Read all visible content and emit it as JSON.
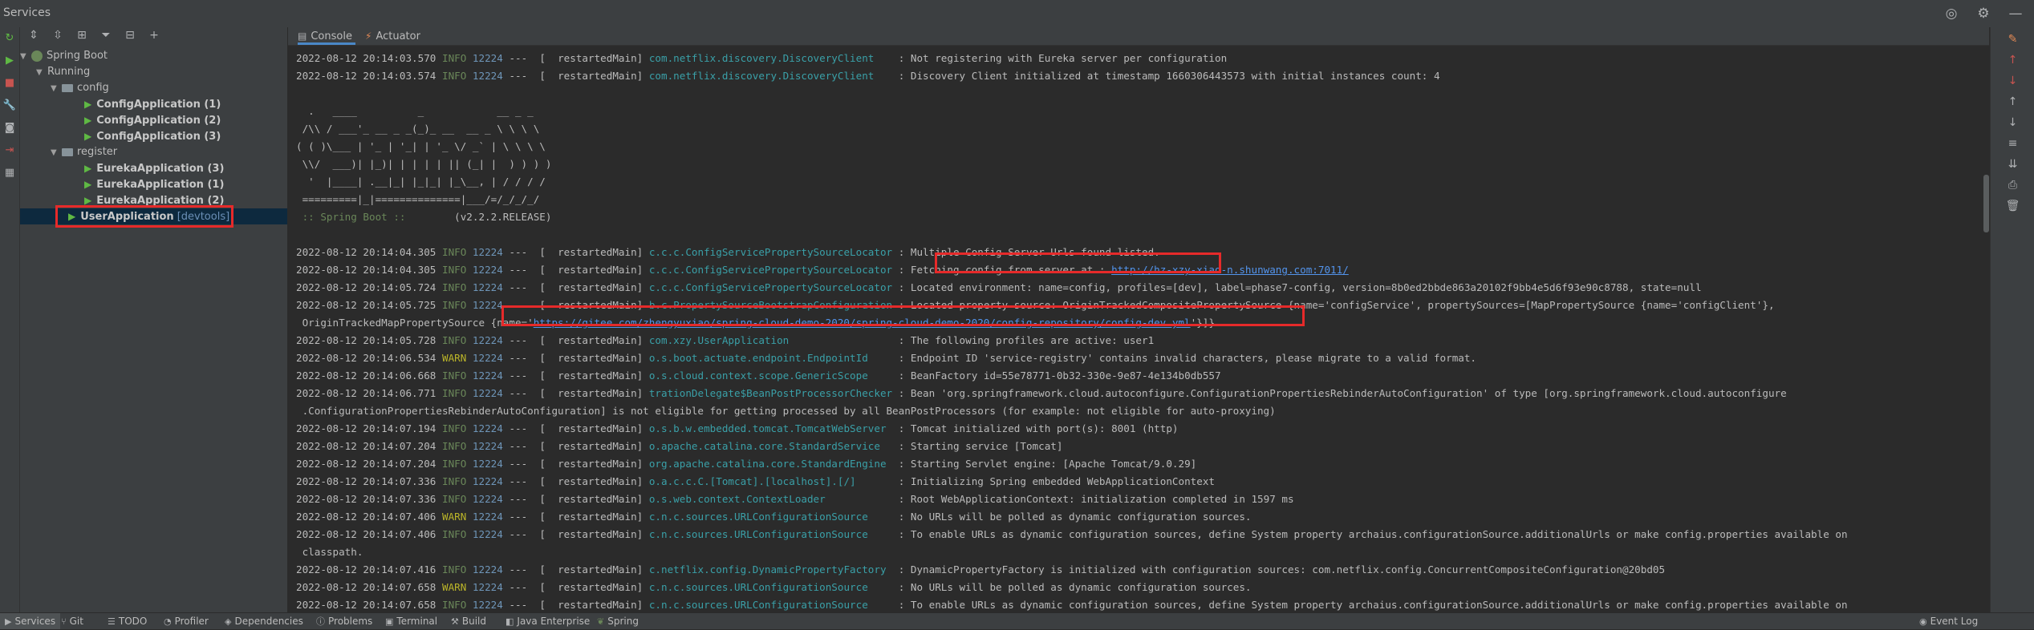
{
  "window": {
    "title": "Services"
  },
  "left_toolbar": {
    "icons": [
      "refresh-icon",
      "run-icon",
      "stop-icon",
      "wrench-icon",
      "camera-icon",
      "exit-icon",
      "layout-icon"
    ]
  },
  "tree_toolbar": {
    "icons": [
      "expand-all-icon",
      "collapse-all-icon",
      "group-icon",
      "filter-icon",
      "new-group-icon",
      "add-service-icon"
    ]
  },
  "tree": {
    "root": "Spring Boot",
    "running": "Running",
    "config_group": "config",
    "config_apps": [
      "ConfigApplication (1)",
      "ConfigApplication (2)",
      "ConfigApplication (3)"
    ],
    "register_group": "register",
    "register_apps": [
      "EurekaApplication (3)",
      "EurekaApplication (1)",
      "EurekaApplication (2)"
    ],
    "user_app": "UserApplication",
    "user_app_tag": "[devtools]"
  },
  "tabs": {
    "console": "Console",
    "actuator": "Actuator"
  },
  "console": {
    "lines": [
      {
        "type": "log",
        "ts": "2022-08-12 20:14:03.570",
        "level": "INFO",
        "pid": "12224",
        "thread": "---  [  restartedMain]",
        "logger": "com.netflix.discovery.DiscoveryClient    ",
        "msg": ": Not registering with Eureka server per configuration"
      },
      {
        "type": "log",
        "ts": "2022-08-12 20:14:03.574",
        "level": "INFO",
        "pid": "12224",
        "thread": "---  [  restartedMain]",
        "logger": "com.netflix.discovery.DiscoveryClient    ",
        "msg": ": Discovery Client initialized at timestamp 1660306443573 with initial instances count: 4"
      },
      {
        "type": "blank"
      },
      {
        "type": "banner",
        "text": "  .   ____          _            __ _ _"
      },
      {
        "type": "banner",
        "text": " /\\\\ / ___'_ __ _ _(_)_ __  __ _ \\ \\ \\ \\"
      },
      {
        "type": "banner",
        "text": "( ( )\\___ | '_ | '_| | '_ \\/ _` | \\ \\ \\ \\"
      },
      {
        "type": "banner",
        "text": " \\\\/  ___)| |_)| | | | | || (_| |  ) ) ) )"
      },
      {
        "type": "banner",
        "text": "  '  |____| .__|_| |_|_| |_\\__, | / / / /"
      },
      {
        "type": "banner",
        "text": " =========|_|==============|___/=/_/_/_/"
      },
      {
        "type": "sbver",
        "label": " :: Spring Boot :: ",
        "version": "       (v2.2.2.RELEASE)"
      },
      {
        "type": "blank"
      },
      {
        "type": "log",
        "ts": "2022-08-12 20:14:04.305",
        "level": "INFO",
        "pid": "12224",
        "thread": "---  [  restartedMain]",
        "logger": "c.c.c.ConfigServicePropertySourceLocator ",
        "msg": ": Multiple Config Server Urls found listed."
      },
      {
        "type": "fetch",
        "ts": "2022-08-12 20:14:04.305",
        "level": "INFO",
        "pid": "12224",
        "thread": "---  [  restartedMain]",
        "logger": "c.c.c.ConfigServicePropertySourceLocator ",
        "msg": ": Fetching config from server at : ",
        "url": "http://hz-xzy-xiao-n.shunwang.com:7011/"
      },
      {
        "type": "log",
        "ts": "2022-08-12 20:14:05.724",
        "level": "INFO",
        "pid": "12224",
        "thread": "---  [  restartedMain]",
        "logger": "c.c.c.ConfigServicePropertySourceLocator ",
        "msg": ": Located environment: name=config, profiles=[dev], label=phase7-config, version=8b0ed2bbde863a20102f9bb4e5d6f93e90c8788, state=null"
      },
      {
        "type": "log",
        "ts": "2022-08-12 20:14:05.725",
        "level": "INFO",
        "pid": "12224",
        "thread": "---  [  restartedMain]",
        "logger": "b.c.PropertySourceBootstrapConfiguration ",
        "msg": ": Located property source: OriginTrackedCompositePropertySource {name='configService', propertySources=[MapPropertySource {name='configClient'},"
      },
      {
        "type": "cont_url",
        "pre": " OriginTrackedMapPropertySource ",
        "a": "{name='",
        "url": "https://gitee.com/zhengyuxiao/spring-cloud-demo-2020/spring-cloud-demo-2020/config-repository/config-dev.yml",
        "b": "'}]}"
      },
      {
        "type": "log",
        "ts": "2022-08-12 20:14:05.728",
        "level": "INFO",
        "pid": "12224",
        "thread": "---  [  restartedMain]",
        "logger": "com.xzy.UserApplication                  ",
        "msg": ": The following profiles are active: user1"
      },
      {
        "type": "log",
        "ts": "2022-08-12 20:14:06.534",
        "level": "WARN",
        "pid": "12224",
        "thread": "---  [  restartedMain]",
        "logger": "o.s.boot.actuate.endpoint.EndpointId     ",
        "msg": ": Endpoint ID 'service-registry' contains invalid characters, please migrate to a valid format."
      },
      {
        "type": "log",
        "ts": "2022-08-12 20:14:06.668",
        "level": "INFO",
        "pid": "12224",
        "thread": "---  [  restartedMain]",
        "logger": "o.s.cloud.context.scope.GenericScope     ",
        "msg": ": BeanFactory id=55e78771-0b32-330e-9e87-4e134b0db557"
      },
      {
        "type": "log",
        "ts": "2022-08-12 20:14:06.771",
        "level": "INFO",
        "pid": "12224",
        "thread": "---  [  restartedMain]",
        "logger": "trationDelegate$BeanPostProcessorChecker ",
        "msg": ": Bean 'org.springframework.cloud.autoconfigure.ConfigurationPropertiesRebinderAutoConfiguration' of type [org.springframework.cloud.autoconfigure"
      },
      {
        "type": "cont",
        "text": " .ConfigurationPropertiesRebinderAutoConfiguration] is not eligible for getting processed by all BeanPostProcessors (for example: not eligible for auto-proxying)"
      },
      {
        "type": "log",
        "ts": "2022-08-12 20:14:07.194",
        "level": "INFO",
        "pid": "12224",
        "thread": "---  [  restartedMain]",
        "logger": "o.s.b.w.embedded.tomcat.TomcatWebServer  ",
        "msg": ": Tomcat initialized with port(s): 8001 (http)"
      },
      {
        "type": "log",
        "ts": "2022-08-12 20:14:07.204",
        "level": "INFO",
        "pid": "12224",
        "thread": "---  [  restartedMain]",
        "logger": "o.apache.catalina.core.StandardService   ",
        "msg": ": Starting service [Tomcat]"
      },
      {
        "type": "log",
        "ts": "2022-08-12 20:14:07.204",
        "level": "INFO",
        "pid": "12224",
        "thread": "---  [  restartedMain]",
        "logger": "org.apache.catalina.core.StandardEngine  ",
        "msg": ": Starting Servlet engine: [Apache Tomcat/9.0.29]"
      },
      {
        "type": "log",
        "ts": "2022-08-12 20:14:07.336",
        "level": "INFO",
        "pid": "12224",
        "thread": "---  [  restartedMain]",
        "logger": "o.a.c.c.C.[Tomcat].[localhost].[/]       ",
        "msg": ": Initializing Spring embedded WebApplicationContext"
      },
      {
        "type": "log",
        "ts": "2022-08-12 20:14:07.336",
        "level": "INFO",
        "pid": "12224",
        "thread": "---  [  restartedMain]",
        "logger": "o.s.web.context.ContextLoader            ",
        "msg": ": Root WebApplicationContext: initialization completed in 1597 ms"
      },
      {
        "type": "log",
        "ts": "2022-08-12 20:14:07.406",
        "level": "WARN",
        "pid": "12224",
        "thread": "---  [  restartedMain]",
        "logger": "c.n.c.sources.URLConfigurationSource     ",
        "msg": ": No URLs will be polled as dynamic configuration sources."
      },
      {
        "type": "log",
        "ts": "2022-08-12 20:14:07.406",
        "level": "INFO",
        "pid": "12224",
        "thread": "---  [  restartedMain]",
        "logger": "c.n.c.sources.URLConfigurationSource     ",
        "msg": ": To enable URLs as dynamic configuration sources, define System property archaius.configurationSource.additionalUrls or make config.properties available on"
      },
      {
        "type": "cont",
        "text": " classpath."
      },
      {
        "type": "log",
        "ts": "2022-08-12 20:14:07.416",
        "level": "INFO",
        "pid": "12224",
        "thread": "---  [  restartedMain]",
        "logger": "c.netflix.config.DynamicPropertyFactory  ",
        "msg": ": DynamicPropertyFactory is initialized with configuration sources: com.netflix.config.ConcurrentCompositeConfiguration@20bd05"
      },
      {
        "type": "log",
        "ts": "2022-08-12 20:14:07.658",
        "level": "WARN",
        "pid": "12224",
        "thread": "---  [  restartedMain]",
        "logger": "c.n.c.sources.URLConfigurationSource     ",
        "msg": ": No URLs will be polled as dynamic configuration sources."
      },
      {
        "type": "log",
        "ts": "2022-08-12 20:14:07.658",
        "level": "INFO",
        "pid": "12224",
        "thread": "---  [  restartedMain]",
        "logger": "c.n.c.sources.URLConfigurationSource     ",
        "msg": ": To enable URLs as dynamic configuration sources, define System property archaius.configurationSource.additionalUrls or make config.properties available on"
      }
    ]
  },
  "right_toolbar": {
    "icons": [
      "clear-icon",
      "up-icon",
      "down-icon",
      "scroll-up-icon",
      "scroll-down-icon",
      "soft-wrap-icon",
      "scroll-to-end-icon",
      "print-icon",
      "trash-icon"
    ]
  },
  "statusbar": {
    "items": [
      "Services",
      "Git",
      "TODO",
      "Profiler",
      "Dependencies",
      "Problems",
      "Terminal",
      "Build",
      "Java Enterprise",
      "Spring"
    ],
    "right": "Event Log"
  },
  "colors": {
    "highlight": "#e62a2a",
    "info": "#6a8759",
    "warn": "#bbb529",
    "logger": "#3aa0a8",
    "link": "#5394ec",
    "background": "#2b2b2b"
  }
}
